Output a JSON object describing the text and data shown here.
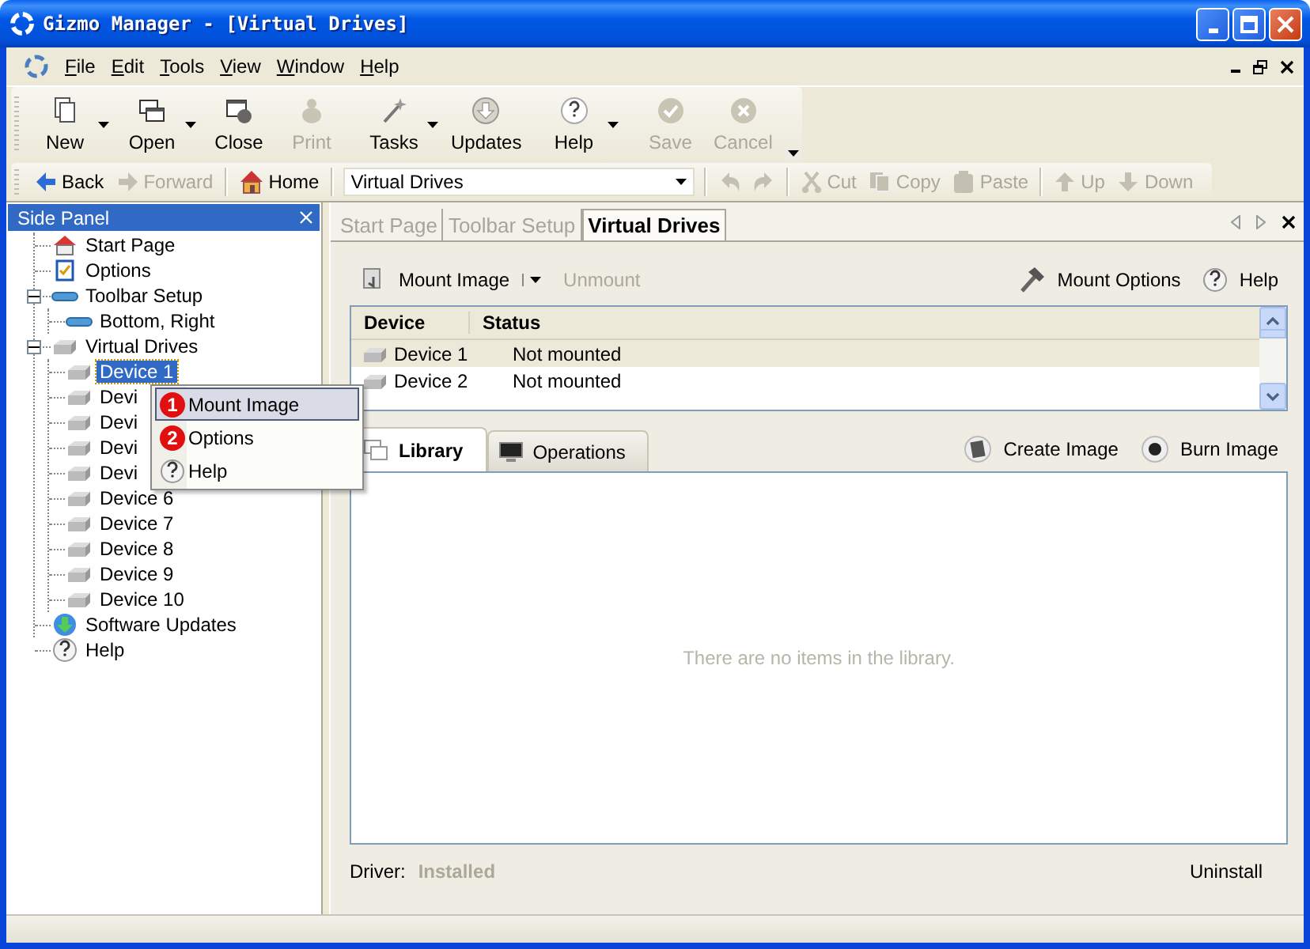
{
  "window": {
    "title": "Gizmo Manager - [Virtual Drives]"
  },
  "menu_bar": {
    "items": [
      "File",
      "Edit",
      "Tools",
      "View",
      "Window",
      "Help"
    ]
  },
  "toolbar": {
    "groups": [
      [
        {
          "label": "New",
          "dropdown": true,
          "disabled": false
        },
        {
          "label": "Open",
          "dropdown": true,
          "disabled": false
        },
        {
          "label": "Close",
          "dropdown": false,
          "disabled": false
        },
        {
          "label": "Print",
          "dropdown": false,
          "disabled": true
        }
      ],
      [
        {
          "label": "Tasks",
          "dropdown": true,
          "disabled": false
        },
        {
          "label": "Updates",
          "dropdown": false,
          "disabled": false
        }
      ],
      [
        {
          "label": "Help",
          "dropdown": true,
          "disabled": false
        }
      ],
      [
        {
          "label": "Save",
          "dropdown": false,
          "disabled": true
        },
        {
          "label": "Cancel",
          "dropdown": false,
          "disabled": true
        }
      ]
    ]
  },
  "navigation_bar": {
    "groups": [
      {
        "kind": "buttons",
        "items": [
          {
            "label": "Back",
            "disabled": false
          },
          {
            "label": "Forward",
            "disabled": true
          }
        ]
      },
      {
        "kind": "buttons",
        "items": [
          {
            "label": "Home",
            "disabled": false
          }
        ]
      },
      {
        "kind": "combo",
        "value": "Virtual Drives"
      },
      {
        "kind": "buttons",
        "items": [
          {
            "disabled": true
          },
          {
            "disabled": true
          }
        ]
      },
      {
        "kind": "buttons",
        "items": [
          {
            "label": "Cut",
            "disabled": true
          },
          {
            "label": "Copy",
            "disabled": true
          },
          {
            "label": "Paste",
            "disabled": true
          }
        ]
      },
      {
        "kind": "buttons",
        "items": [
          {
            "label": "Up",
            "disabled": true
          },
          {
            "label": "Down",
            "disabled": true
          }
        ]
      }
    ]
  },
  "side_panel": {
    "title": "Side Panel",
    "tree": [
      {
        "label": "Start Page",
        "kind": "page",
        "selected": false
      },
      {
        "label": "Options",
        "kind": "options",
        "selected": false
      },
      {
        "label": "Toolbar Setup",
        "kind": "toolbar",
        "selected": false,
        "expanded": true,
        "children": [
          {
            "label": "Bottom, Right",
            "kind": "toolbar",
            "selected": false
          }
        ]
      },
      {
        "label": "Virtual Drives",
        "kind": "drive",
        "selected": false,
        "expanded": true,
        "children": [
          {
            "label": "Device 1",
            "kind": "drive",
            "selected": true
          },
          {
            "label": "Devi",
            "kind": "drive",
            "selected": false
          },
          {
            "label": "Devi",
            "kind": "drive",
            "selected": false
          },
          {
            "label": "Devi",
            "kind": "drive",
            "selected": false
          },
          {
            "label": "Devi",
            "kind": "drive",
            "selected": false
          },
          {
            "label": "Device 6",
            "kind": "drive",
            "selected": false
          },
          {
            "label": "Device 7",
            "kind": "drive",
            "selected": false
          },
          {
            "label": "Device 8",
            "kind": "drive",
            "selected": false
          },
          {
            "label": "Device 9",
            "kind": "drive",
            "selected": false
          },
          {
            "label": "Device 10",
            "kind": "drive",
            "selected": false
          }
        ]
      },
      {
        "label": "Software Updates",
        "kind": "update",
        "selected": false
      },
      {
        "label": "Help",
        "kind": "help",
        "selected": false
      }
    ]
  },
  "context_menu": {
    "items": [
      {
        "badge": "1",
        "label": "Mount Image",
        "selected": true
      },
      {
        "badge": "2",
        "label": "Options",
        "selected": false
      },
      {
        "label": "Help",
        "selected": false
      }
    ]
  },
  "document_tabs": [
    {
      "label": "Start Page",
      "selected": false
    },
    {
      "label": "Toolbar Setup",
      "selected": false
    },
    {
      "label": "Virtual Drives",
      "selected": true
    }
  ],
  "actions": {
    "left": [
      {
        "label": "Mount Image",
        "dropdown": true,
        "disabled": false
      },
      {
        "label": "Unmount",
        "dropdown": false,
        "disabled": true
      }
    ],
    "right": [
      {
        "label": "Mount Options",
        "disabled": false
      },
      {
        "label": "Help",
        "disabled": false
      }
    ]
  },
  "device_list": {
    "columns": [
      "Device",
      "Status"
    ],
    "rows": [
      {
        "device": "Device 1",
        "status": "Not mounted",
        "selected": true
      },
      {
        "device": "Device 2",
        "status": "Not mounted",
        "selected": false
      }
    ]
  },
  "library_tabs": [
    {
      "label": "Library",
      "selected": true
    },
    {
      "label": "Operations",
      "selected": false
    }
  ],
  "library_actions": [
    {
      "label": "Create Image"
    },
    {
      "label": "Burn Image"
    }
  ],
  "library": {
    "empty_message": "There are no items in the library."
  },
  "footer": {
    "driver_label": "Driver:",
    "driver_status": "Installed",
    "uninstall": "Uninstall"
  }
}
